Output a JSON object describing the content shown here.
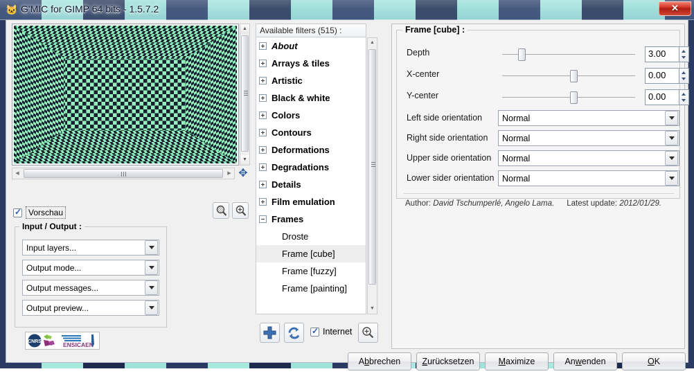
{
  "window": {
    "title": "G'MIC for GIMP 64 bits - 1.5.7.2",
    "icon": "gmic-cat-icon",
    "close_label": "✕"
  },
  "preview": {
    "checkbox_label": "Vorschau",
    "checkbox_checked": true,
    "move_icon": "move-crosshair-icon",
    "zoom_out_icon": "zoom-out-icon",
    "zoom_in_icon": "zoom-in-icon",
    "image_colors": {
      "light": "#93efbc",
      "dark": "#18202f"
    }
  },
  "io": {
    "legend": "Input / Output :",
    "combos": [
      {
        "value": "Input layers...",
        "name": "input-layers-combo"
      },
      {
        "value": "Output mode...",
        "name": "output-mode-combo"
      },
      {
        "value": "Output messages...",
        "name": "output-messages-combo"
      },
      {
        "value": "Output preview...",
        "name": "output-preview-combo"
      }
    ],
    "logo_text": "ENSICAEN"
  },
  "filters": {
    "header": "Available filters (515) :",
    "tree": [
      {
        "label": "About",
        "type": "about",
        "expanded": false
      },
      {
        "label": "Arrays & tiles",
        "type": "category",
        "expanded": false
      },
      {
        "label": "Artistic",
        "type": "category",
        "expanded": false
      },
      {
        "label": "Black & white",
        "type": "category",
        "expanded": false
      },
      {
        "label": "Colors",
        "type": "category",
        "expanded": false
      },
      {
        "label": "Contours",
        "type": "category",
        "expanded": false
      },
      {
        "label": "Deformations",
        "type": "category",
        "expanded": false
      },
      {
        "label": "Degradations",
        "type": "category",
        "expanded": false
      },
      {
        "label": "Details",
        "type": "category",
        "expanded": false
      },
      {
        "label": "Film emulation",
        "type": "category",
        "expanded": false
      },
      {
        "label": "Frames",
        "type": "category",
        "expanded": true
      },
      {
        "label": "Droste",
        "type": "leaf",
        "selected": false
      },
      {
        "label": "Frame [cube]",
        "type": "leaf",
        "selected": true
      },
      {
        "label": "Frame [fuzzy]",
        "type": "leaf",
        "selected": false
      },
      {
        "label": "Frame [painting]",
        "type": "leaf",
        "selected": false
      }
    ],
    "toolbar": {
      "add_icon": "plus-icon",
      "refresh_icon": "refresh-icon",
      "zoom_icon": "zoom-in-icon",
      "internet_label": "Internet",
      "internet_checked": true
    }
  },
  "params": {
    "legend": "Frame [cube] :",
    "sliders": [
      {
        "label": "Depth",
        "value": "3.00",
        "position_pct": 13,
        "name": "depth"
      },
      {
        "label": "X-center",
        "value": "0.00",
        "position_pct": 51,
        "name": "x-center"
      },
      {
        "label": "Y-center",
        "value": "0.00",
        "position_pct": 51,
        "name": "y-center"
      }
    ],
    "combos": [
      {
        "label": "Left side orientation",
        "value": "Normal",
        "name": "left-side-orientation"
      },
      {
        "label": "Right side orientation",
        "value": "Normal",
        "name": "right-side-orientation"
      },
      {
        "label": "Upper side orientation",
        "value": "Normal",
        "name": "upper-side-orientation"
      },
      {
        "label": "Lower sider orientation",
        "value": "Normal",
        "name": "lower-side-orientation"
      }
    ],
    "author_prefix": "Author: ",
    "author_names": "David Tschumperlé, Angelo Lama.",
    "update_prefix": "Latest update: ",
    "update_date": "2012/01/29."
  },
  "buttons": {
    "cancel": {
      "pre": "A",
      "key": "b",
      "post": "brechen"
    },
    "reset": {
      "pre": "",
      "key": "Z",
      "post": "urücksetzen"
    },
    "maximize": {
      "pre": "",
      "key": "M",
      "post": "aximize"
    },
    "apply": {
      "pre": "An",
      "key": "w",
      "post": "enden"
    },
    "ok": {
      "pre": "",
      "key": "O",
      "post": "K"
    }
  }
}
